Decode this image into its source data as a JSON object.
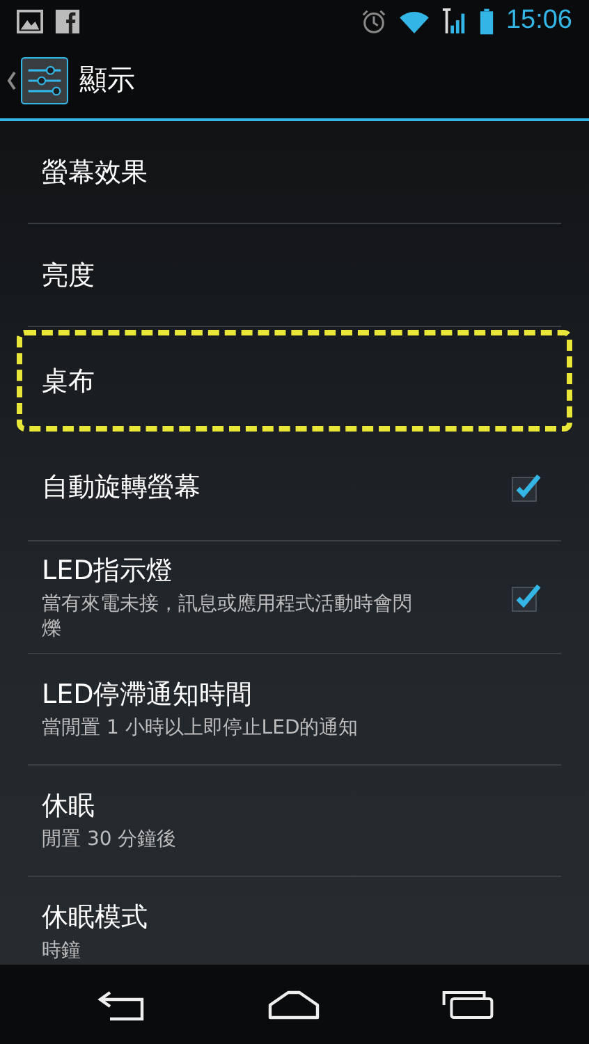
{
  "status_bar": {
    "time": "15:06"
  },
  "action_bar": {
    "title": "顯示"
  },
  "items": [
    {
      "kind": "plain",
      "title": "螢幕效果",
      "highlighted": false
    },
    {
      "kind": "plain",
      "title": "亮度",
      "highlighted": false
    },
    {
      "kind": "plain",
      "title": "桌布",
      "highlighted": true
    },
    {
      "kind": "checkbox",
      "title": "自動旋轉螢幕",
      "checked": true,
      "highlighted": false
    },
    {
      "kind": "checkbox",
      "title": "LED指示燈",
      "summary": "當有來電未接，訊息或應用程式活動時會閃爍",
      "checked": true,
      "highlighted": false
    },
    {
      "kind": "plain",
      "title": "LED停滯通知時間",
      "summary": "當閒置 1 小時以上即停止LED的通知",
      "highlighted": false
    },
    {
      "kind": "plain",
      "title": "休眠",
      "summary": "閒置 30 分鐘後",
      "highlighted": false
    },
    {
      "kind": "plain",
      "title": "休眠模式",
      "summary": "時鐘",
      "highlighted": false
    }
  ]
}
